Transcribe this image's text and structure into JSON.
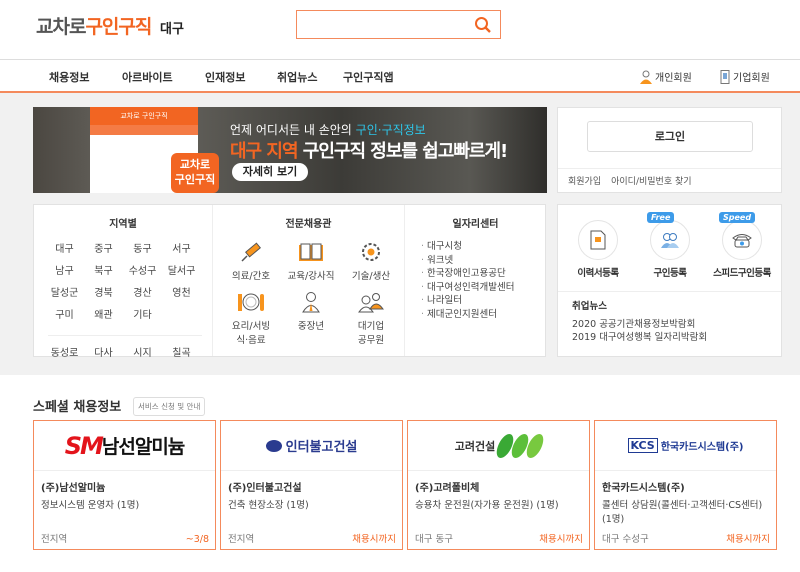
{
  "header": {
    "logo_gray": "교차로",
    "logo_orange": "구인구직",
    "region": "대구",
    "search_placeholder": ""
  },
  "nav": {
    "items": [
      "채용정보",
      "아르바이트",
      "인재정보",
      "취업뉴스",
      "구인구직앱"
    ],
    "personal": "개인회원",
    "company": "기업회원"
  },
  "banner": {
    "app_bar": "교차로 구인구직",
    "line1_a": "언제 어디서든 내 손안의 ",
    "line1_b": "구인·구직정보",
    "line2_a": "대구 지역",
    "line2_b": " 구인구직 정보를 쉽고빠르게!",
    "button": "자세히 보기",
    "app_logo_1": "교차로",
    "app_logo_2": "구인구직"
  },
  "login": {
    "button": "로그인",
    "links": [
      "회원가입",
      "아이디/비밀번호 찾기"
    ]
  },
  "regions": {
    "title": "지역별",
    "items": [
      "대구",
      "중구",
      "동구",
      "서구",
      "남구",
      "북구",
      "수성구",
      "달서구",
      "달성군",
      "경북",
      "경산",
      "영천",
      "구미",
      "왜관",
      "기타"
    ],
    "extra": [
      "동성로",
      "다사",
      "시지",
      "칠곡"
    ]
  },
  "special": {
    "title": "전문채용관",
    "items": [
      {
        "label": "의료/간호",
        "icon": "syringe-icon"
      },
      {
        "label": "교육/강사직",
        "icon": "book-icon"
      },
      {
        "label": "기술/생산",
        "icon": "gear-icon"
      },
      {
        "label": "요리/서빙\n식·음료",
        "icon": "dining-icon"
      },
      {
        "label": "중장년",
        "icon": "person-tie-icon"
      },
      {
        "label": "대기업\n공무원",
        "icon": "people-icon"
      }
    ]
  },
  "jobcenter": {
    "title": "일자리센터",
    "items": [
      "대구시청",
      "워크넷",
      "한국장애인고용공단",
      "대구여성인력개발센터",
      "나라일터",
      "제대군인지원센터"
    ]
  },
  "register": {
    "items": [
      {
        "label": "이력서등록",
        "tag": ""
      },
      {
        "label": "구인등록",
        "tag": "Free"
      },
      {
        "label": "스피드구인등록",
        "tag": "Speed"
      }
    ]
  },
  "news": {
    "title": "취업뉴스",
    "items": [
      "2020 공공기관채용정보박람회",
      "2019 대구여성행복 일자리박람회"
    ]
  },
  "special_jobs": {
    "title": "스페셜 채용정보",
    "guide": "서비스 신청 및 안내",
    "cards": [
      {
        "logo": "SM남선알미늄",
        "company": "(주)남선알미늄",
        "job": "정보시스템 운영자 (1명)",
        "location": "전지역",
        "deadline": "~3/8"
      },
      {
        "logo": "인터불고건설",
        "company": "(주)인터불고건설",
        "job": "건축 현장소장 (1명)",
        "location": "전지역",
        "deadline": "채용시까지"
      },
      {
        "logo": "고려건설",
        "company": "(주)고려폴비체",
        "job": "승용차 운전원(자가용 운전원) (1명)",
        "location": "대구 동구",
        "deadline": "채용시까지"
      },
      {
        "logo": "KCS 한국카드시스템(주)",
        "company": "한국카드시스템(주)",
        "job": "콜센터 상담원(콜센터·고객센터·CS센터) (1명)",
        "location": "대구 수성구",
        "deadline": "채용시까지"
      }
    ]
  },
  "colors": {
    "accent": "#f26522",
    "border": "#f48a5c",
    "tag": "#3d9be9"
  }
}
